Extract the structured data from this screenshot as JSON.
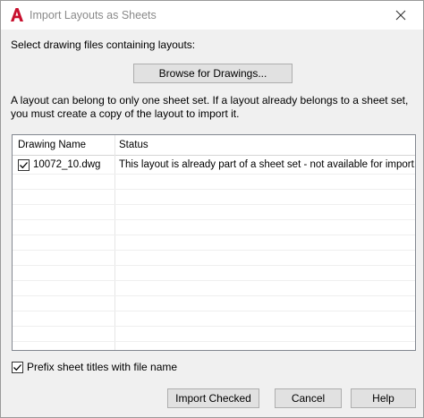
{
  "window": {
    "title": "Import Layouts as Sheets",
    "icon": "autocad-a-icon",
    "icon_color": "#c8102e"
  },
  "select_label": "Select drawing files containing layouts:",
  "browse_button": "Browse for Drawings...",
  "info_text": "A layout can belong to only one sheet set. If a layout already belongs to a sheet set, you must create a copy of the layout to import it.",
  "table": {
    "columns": [
      "Drawing Name",
      "Status"
    ],
    "rows": [
      {
        "checked": true,
        "name": "10072_10.dwg",
        "status": "This layout is already part of a sheet set - not available for import."
      }
    ]
  },
  "prefix_option": {
    "checked": true,
    "label": "Prefix sheet titles with file name"
  },
  "buttons": {
    "import": "Import Checked",
    "cancel": "Cancel",
    "help": "Help"
  }
}
